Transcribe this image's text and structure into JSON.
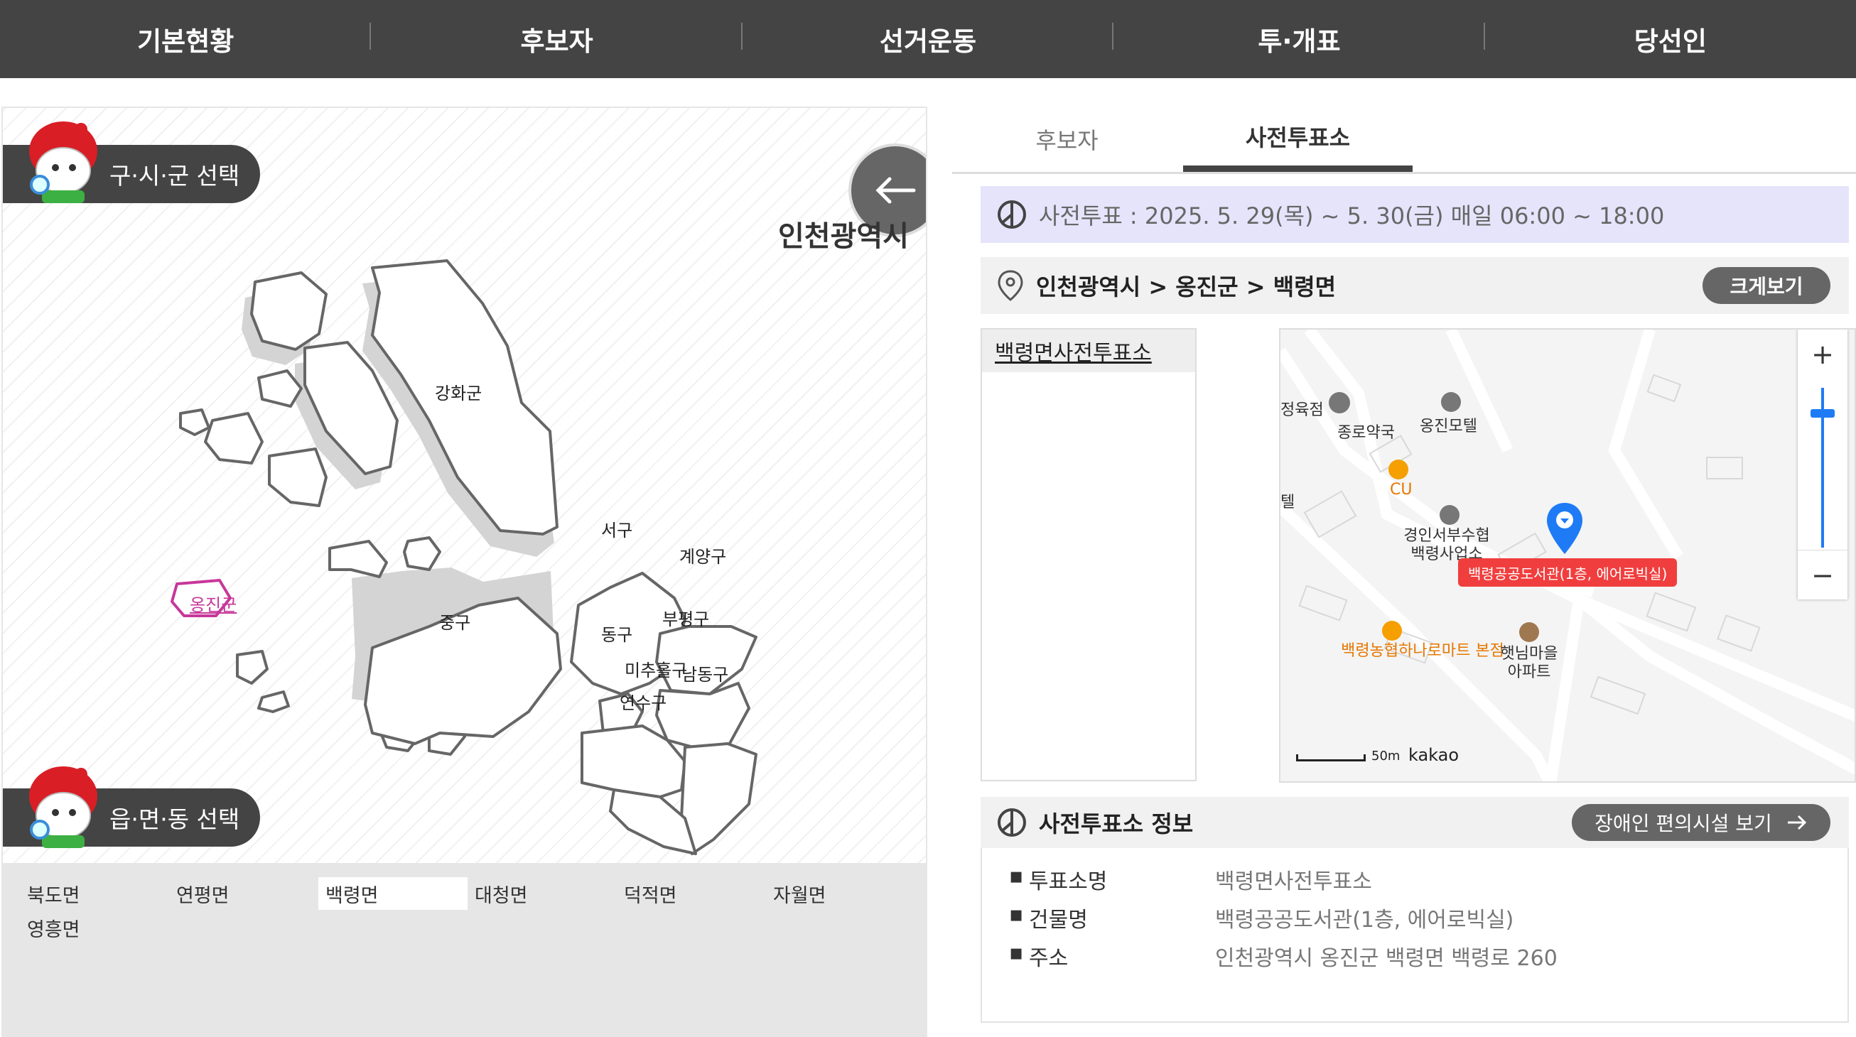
{
  "nav": {
    "items": [
      "기본현황",
      "후보자",
      "선거운동",
      "투·개표",
      "당선인"
    ]
  },
  "left": {
    "sigungu_title": "구·시·군 선택",
    "emd_title": "읍·면·동 선택",
    "city": "인천광역시",
    "districts": [
      "강화군",
      "서구",
      "계양구",
      "옹진군",
      "중구",
      "부평구",
      "동구",
      "미추홀구",
      "남동구",
      "연수구"
    ],
    "selected_district": "옹진군",
    "dongs": [
      "북도면",
      "연평면",
      "백령면",
      "대청면",
      "덕적면",
      "자월면",
      "영흥면"
    ],
    "selected_dong": "백령면"
  },
  "tabs": [
    "후보자",
    "사전투표소"
  ],
  "active_tab": "사전투표소",
  "period": "사전투표 : 2025. 5. 29(목) ~ 5. 30(금) 매일 06:00 ~ 18:00",
  "location_path": "인천광역시 > 옹진군 > 백령면",
  "enlarge_label": "크게보기",
  "station_list": [
    "백령면사전투표소"
  ],
  "map": {
    "pois": [
      "정육점",
      "종로약국",
      "옹진모텔",
      "CU",
      "텔",
      "경인서부수협 백령사업소",
      "백령농협하나로마트 본점",
      "햇님마을 아파트"
    ],
    "marker_label": "백령공공도서관(1층, 에어로빅실)",
    "scale": "50m",
    "brand": "kakao",
    "zoom_in": "+",
    "zoom_out": "−",
    "accent": "#f03e3e",
    "marker_color": "#1e7bf5"
  },
  "info": {
    "title": "사전투표소 정보",
    "facility_button": "장애인 편의시설 보기",
    "rows": [
      {
        "k": "투표소명",
        "v": "백령면사전투표소"
      },
      {
        "k": "건물명",
        "v": "백령공공도서관(1층, 에어로빅실)"
      },
      {
        "k": "주소",
        "v": "인천광역시 옹진군 백령면 백령로 260"
      }
    ]
  }
}
